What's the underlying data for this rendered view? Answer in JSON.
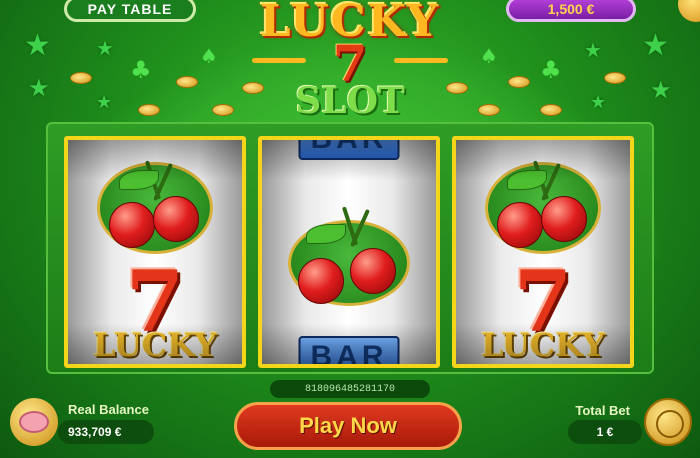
{
  "header": {
    "paytable_label": "PAY TABLE",
    "balance_chip": "1,500 €"
  },
  "logo": {
    "line1": "LUCKY",
    "line2": "7",
    "line3": "SLOT"
  },
  "reels": [
    {
      "top": "cherry",
      "bottom": "lucky-seven"
    },
    {
      "top_partial": "BAR",
      "center": "cherry",
      "bottom_partial": "BAR"
    },
    {
      "top": "cherry",
      "bottom": "lucky-seven"
    }
  ],
  "symbols": {
    "seven": "7",
    "lucky": "LUCKY",
    "bar": "BAR"
  },
  "serial": "818096485281170",
  "footer": {
    "real_balance_label": "Real Balance",
    "real_balance_value": "933,709 €",
    "play_label": "Play Now",
    "total_bet_label": "Total Bet",
    "total_bet_value": "1 €"
  },
  "colors": {
    "background": "#1f8f1c",
    "accent_gold": "#f5d51a",
    "play_button": "#c82612",
    "balance_chip": "#9b30c8"
  },
  "icons": {
    "piggy_bank": "piggy-bank-icon",
    "coins": "coin-stack-icon"
  }
}
